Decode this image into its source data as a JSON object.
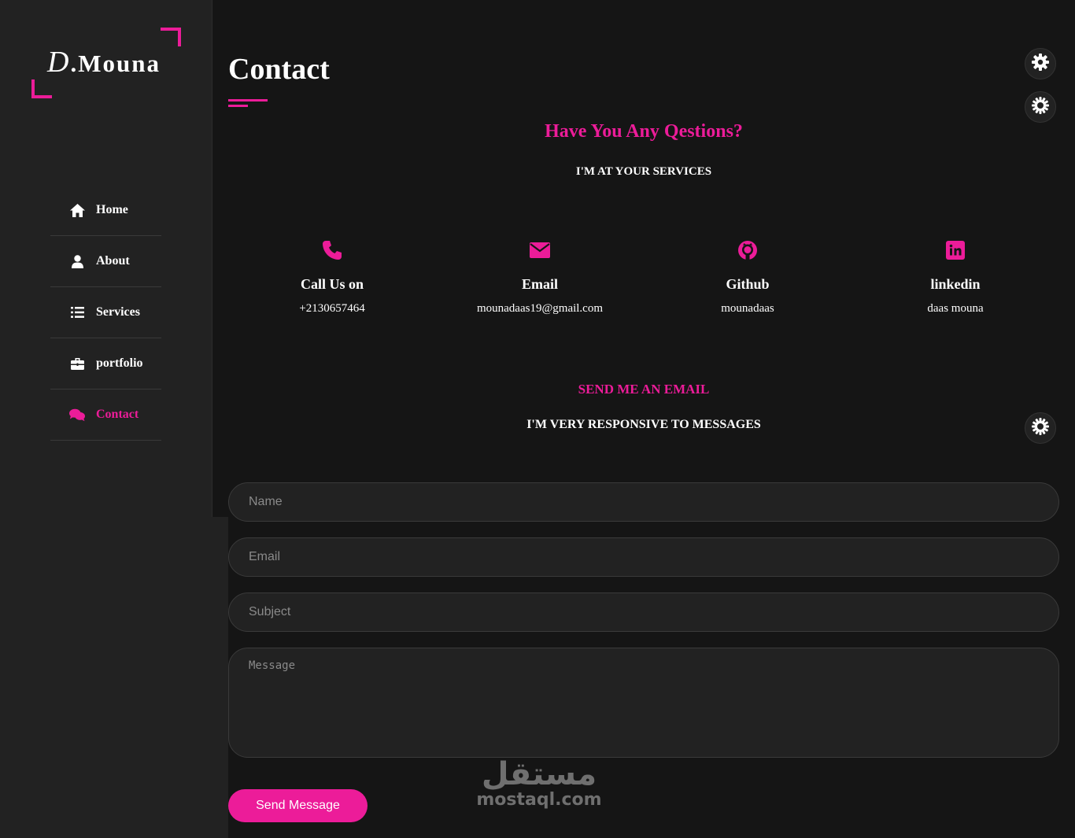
{
  "logo": {
    "initial": "D",
    "rest": ".Mouna"
  },
  "nav": {
    "items": [
      {
        "label": "Home",
        "icon": "home-icon"
      },
      {
        "label": "About",
        "icon": "user-icon"
      },
      {
        "label": "Services",
        "icon": "list-icon"
      },
      {
        "label": "portfolio",
        "icon": "briefcase-icon"
      },
      {
        "label": "Contact",
        "icon": "comments-icon",
        "active": true
      }
    ]
  },
  "page": {
    "title": "Contact"
  },
  "intro": {
    "heading": "Have You Any Qestions?",
    "subheading": "I'M AT YOUR SERVICES"
  },
  "contacts": [
    {
      "title": "Call Us on",
      "value": "+2130657464",
      "icon": "phone-icon"
    },
    {
      "title": "Email",
      "value": "mounadaas19@gmail.com",
      "icon": "envelope-icon"
    },
    {
      "title": "Github",
      "value": "mounadaas",
      "icon": "github-icon"
    },
    {
      "title": "linkedin",
      "value": "daas mouna",
      "icon": "linkedin-icon"
    }
  ],
  "email_section": {
    "heading": "SEND ME AN EMAIL",
    "subheading": "I'M VERY RESPONSIVE TO MESSAGES"
  },
  "form": {
    "name_placeholder": "Name",
    "email_placeholder": "Email",
    "subject_placeholder": "Subject",
    "message_placeholder": "Message",
    "submit_label": "Send Message"
  },
  "watermark": {
    "arabic": "مستقل",
    "latin": "mostaql.com"
  },
  "colors": {
    "accent": "#ec1c99",
    "background": "#151515",
    "sidebar": "#222222"
  }
}
